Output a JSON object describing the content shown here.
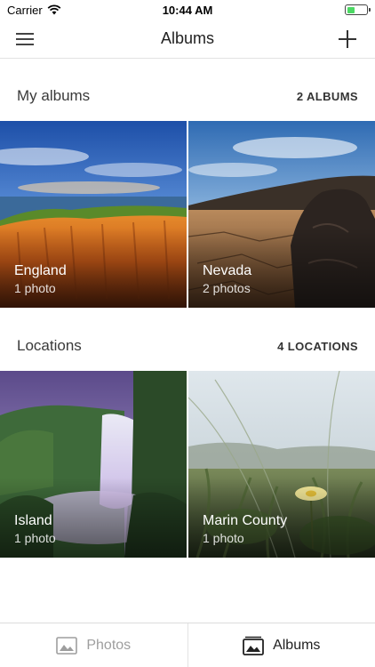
{
  "status_bar": {
    "carrier": "Carrier",
    "time": "10:44 AM",
    "battery_level": 0.4,
    "battery_color": "#4cd964"
  },
  "header": {
    "title": "Albums",
    "menu_icon": "hamburger-menu-icon",
    "add_icon": "plus-icon"
  },
  "my_albums": {
    "title": "My albums",
    "count_label": "2 ALBUMS",
    "items": [
      {
        "name": "England",
        "count": "1 photo"
      },
      {
        "name": "Nevada",
        "count": "2 photos"
      }
    ]
  },
  "locations": {
    "title": "Locations",
    "count_label": "4 LOCATIONS",
    "items": [
      {
        "name": "Island",
        "count": "1 photo"
      },
      {
        "name": "Marin County",
        "count": "1 photo"
      }
    ]
  },
  "tab_bar": {
    "tabs": [
      {
        "label": "Photos",
        "icon": "photo-icon",
        "active": false
      },
      {
        "label": "Albums",
        "icon": "albums-icon",
        "active": true
      }
    ]
  }
}
